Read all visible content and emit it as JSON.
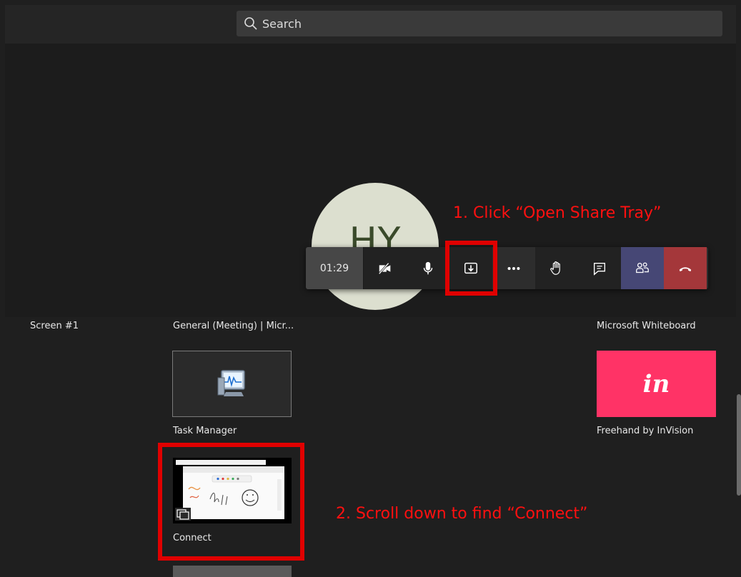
{
  "search": {
    "placeholder": "Search"
  },
  "avatar": {
    "initials": "HY"
  },
  "toolbar": {
    "timer": "01:29"
  },
  "annotations": {
    "step1": "1. Click “Open Share Tray”",
    "step2": "2. Scroll down to find “Connect”"
  },
  "tray": {
    "row1_labels": [
      "Screen #1",
      "General (Meeting) | Micr...",
      "Microsoft Whiteboard"
    ],
    "items": [
      {
        "label": "Task Manager"
      },
      {
        "label": "Freehand by InVision",
        "logo_text": "in"
      },
      {
        "label": "Connect"
      }
    ]
  },
  "colors": {
    "accent_red": "#e00000",
    "invision": "#ff3366",
    "hangup": "#a4373a",
    "people": "#464775"
  }
}
